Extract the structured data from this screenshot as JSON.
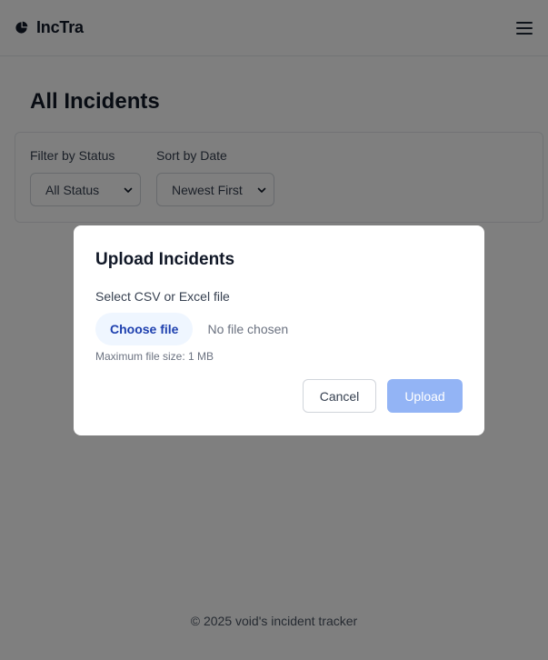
{
  "header": {
    "brand_name": "IncTra",
    "logo_icon": "pie-logo-icon",
    "menu_icon": "hamburger-menu-icon"
  },
  "main": {
    "title": "All Incidents",
    "filters": {
      "status_label": "Filter by Status",
      "status_value": "All Status",
      "sort_label": "Sort by Date",
      "sort_value": "Newest First"
    }
  },
  "modal": {
    "title": "Upload Incidents",
    "field_label": "Select CSV or Excel file",
    "choose_file_label": "Choose file",
    "no_file_text": "No file chosen",
    "hint": "Maximum file size: 1 MB",
    "cancel_label": "Cancel",
    "upload_label": "Upload"
  },
  "footer": {
    "text": "© 2025 void's incident tracker"
  },
  "colors": {
    "overlay": "rgba(0,0,0,0.5)",
    "upload_disabled": "#93b4f5",
    "choose_file_bg": "#eff6ff",
    "choose_file_text": "#1e40af"
  }
}
